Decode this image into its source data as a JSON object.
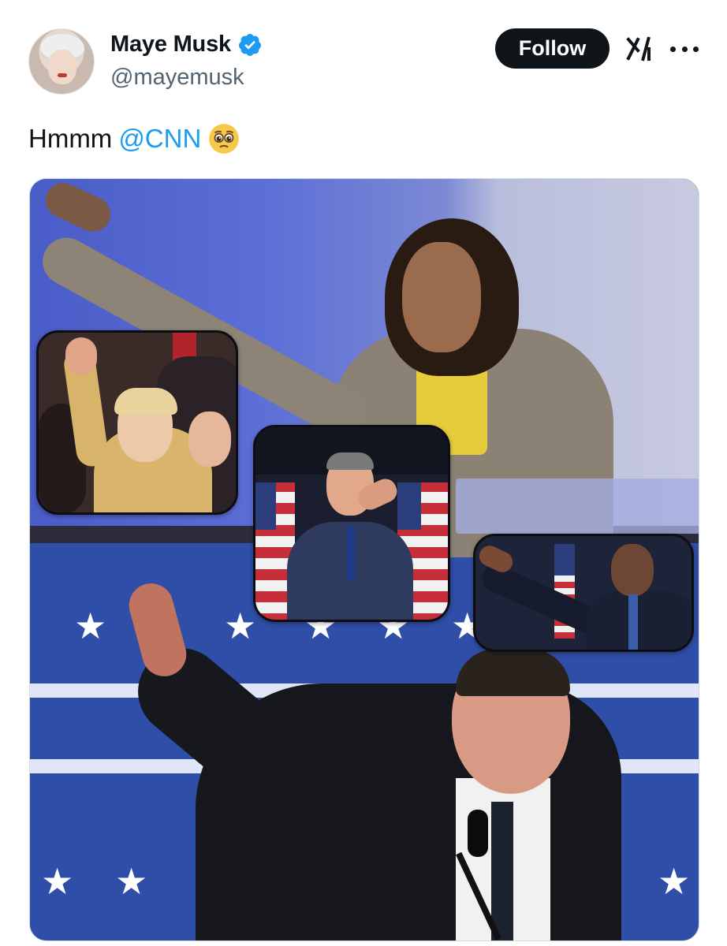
{
  "tweet": {
    "author": {
      "display_name": "Maye Musk",
      "handle": "@mayemusk",
      "verified": true,
      "avatar_icon": "profile-avatar"
    },
    "actions": {
      "follow_label": "Follow",
      "grok_icon": "grok-icon",
      "more_icon": "more-dots-icon"
    },
    "text": {
      "body": "Hmmm",
      "mention": "@CNN",
      "emoji": "pleading-face-emoji"
    },
    "media": {
      "type": "image-collage",
      "description_icon": "collage-image"
    }
  },
  "colors": {
    "accent": "#1d9bf0",
    "follow_bg": "#0f1419",
    "verified": "#1d9bf0",
    "text_secondary": "#536471"
  }
}
